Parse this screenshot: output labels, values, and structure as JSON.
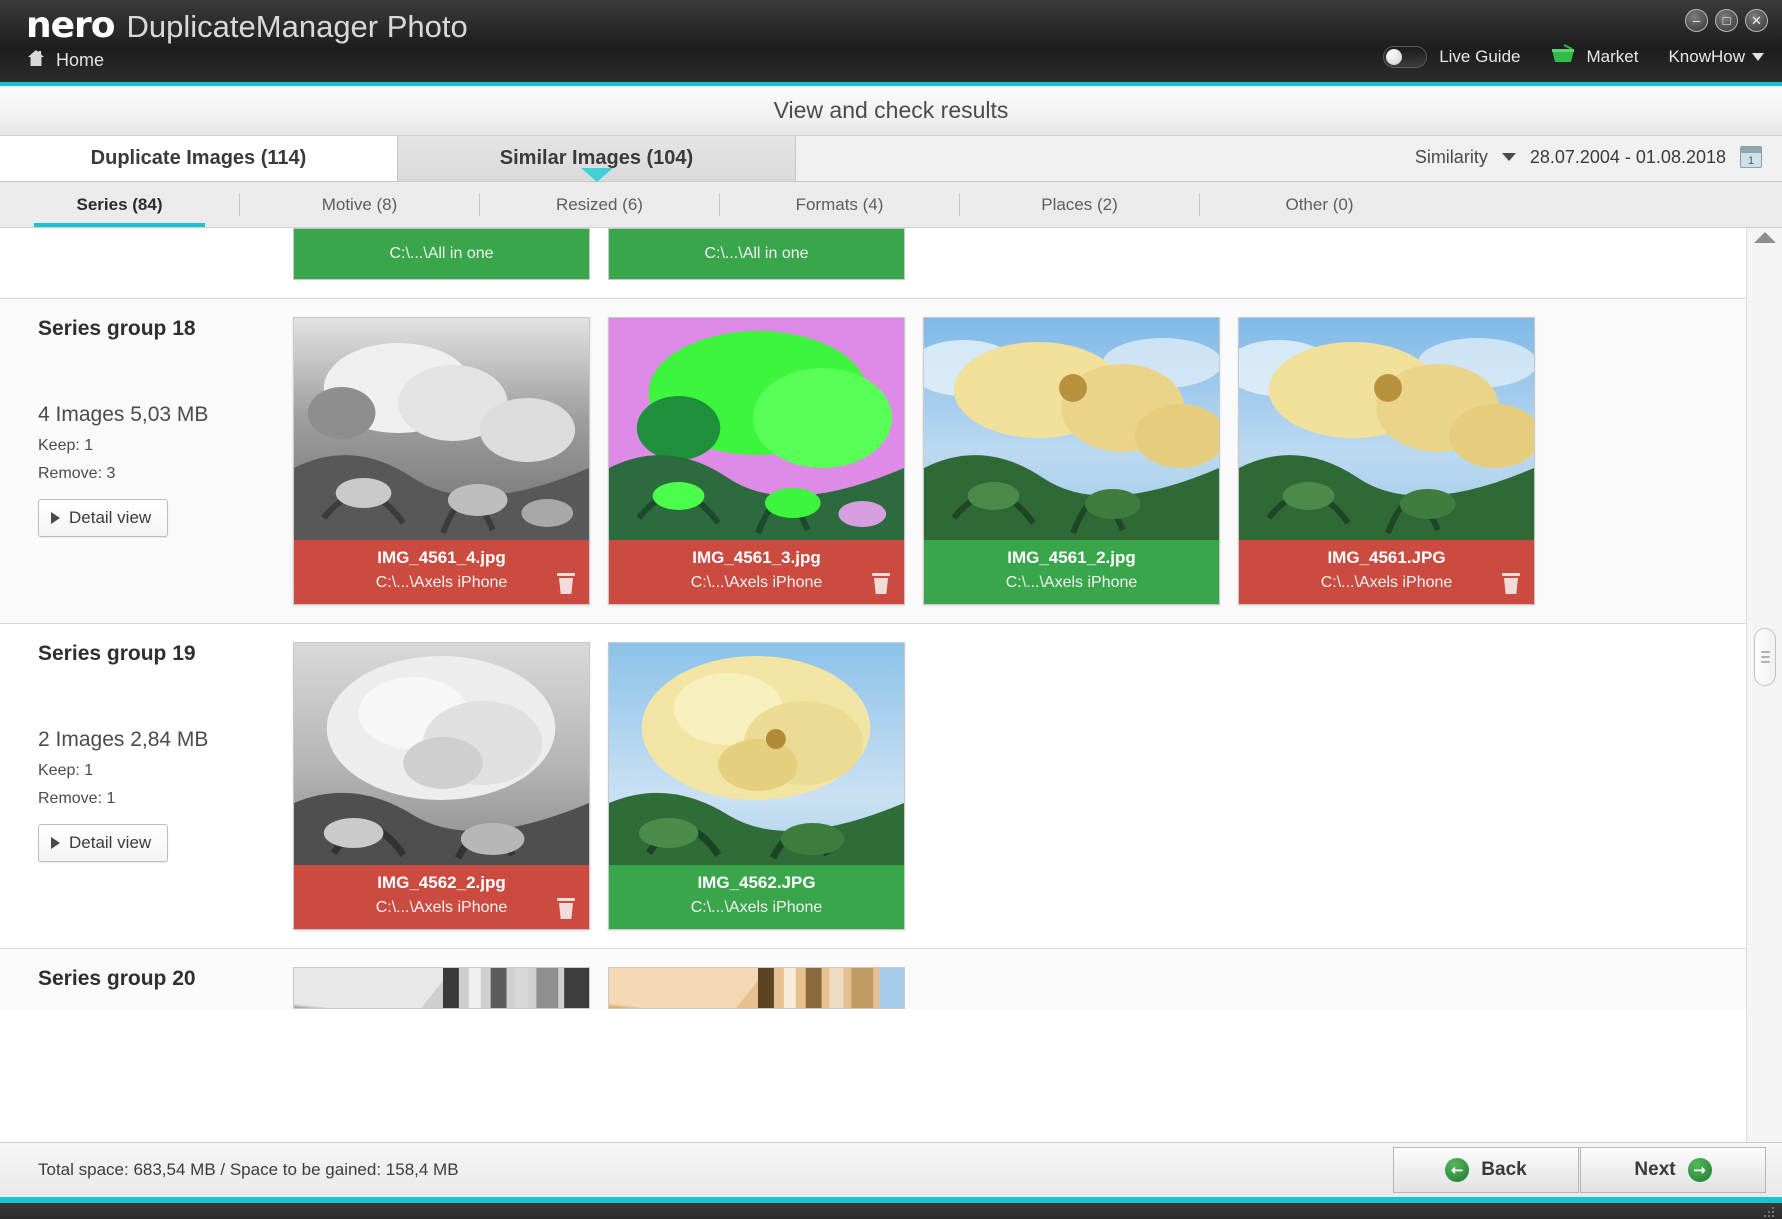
{
  "titlebar": {
    "brand": "nero",
    "app_name": "DuplicateManager Photo",
    "home_label": "Home",
    "live_guide_label": "Live Guide",
    "market_label": "Market",
    "knowhow_label": "KnowHow",
    "minimize_glyph": "–",
    "maximize_glyph": "□",
    "close_glyph": "✕",
    "accent_color": "#17c4cf"
  },
  "header": {
    "title": "View and check results"
  },
  "main_tabs": [
    {
      "label": "Duplicate Images (114)",
      "active": true
    },
    {
      "label": "Similar Images (104)",
      "active": false
    }
  ],
  "filterbar": {
    "similarity_label": "Similarity",
    "date_range": "28.07.2004 - 01.08.2018",
    "calendar_day": "1"
  },
  "sub_tabs": [
    {
      "label": "Series (84)",
      "active": true
    },
    {
      "label": "Motive (8)",
      "active": false
    },
    {
      "label": "Resized (6)",
      "active": false
    },
    {
      "label": "Formats (4)",
      "active": false
    },
    {
      "label": "Places (2)",
      "active": false
    },
    {
      "label": "Other (0)",
      "active": false
    }
  ],
  "partial_top": {
    "cards": [
      {
        "path": "C:\\...\\All in one",
        "state": "keep"
      },
      {
        "path": "C:\\...\\All in one",
        "state": "keep"
      }
    ]
  },
  "groups": [
    {
      "title": "Series group 18",
      "count_label": "4 Images  5,03 MB",
      "keep_label": "Keep: 1",
      "remove_label": "Remove: 3",
      "detail_label": "Detail view",
      "images": [
        {
          "name": "IMG_4561_4.jpg",
          "path": "C:\\...\\Axels iPhone",
          "state": "remove",
          "style": "gray-roses"
        },
        {
          "name": "IMG_4561_3.jpg",
          "path": "C:\\...\\Axels iPhone",
          "state": "remove",
          "style": "neon-roses"
        },
        {
          "name": "IMG_4561_2.jpg",
          "path": "C:\\...\\Axels iPhone",
          "state": "keep",
          "style": "yellow-roses"
        },
        {
          "name": "IMG_4561.JPG",
          "path": "C:\\...\\Axels iPhone",
          "state": "remove",
          "style": "yellow-roses"
        }
      ]
    },
    {
      "title": "Series group 19",
      "count_label": "2 Images  2,84 MB",
      "keep_label": "Keep: 1",
      "remove_label": "Remove: 1",
      "detail_label": "Detail view",
      "images": [
        {
          "name": "IMG_4562_2.jpg",
          "path": "C:\\...\\Axels iPhone",
          "state": "remove",
          "style": "gray-rose-close"
        },
        {
          "name": "IMG_4562.JPG",
          "path": "C:\\...\\Axels iPhone",
          "state": "keep",
          "style": "yellow-rose-close"
        }
      ]
    }
  ],
  "partial_bottom": {
    "title": "Series group 20",
    "cards": [
      {
        "style": "gray-building"
      },
      {
        "style": "ochre-building"
      }
    ]
  },
  "footer": {
    "status": "Total space: 683,54 MB / Space to be gained: 158,4 MB",
    "back_label": "Back",
    "next_label": "Next",
    "back_glyph": "←",
    "next_glyph": "→"
  },
  "colors": {
    "remove": "#cb4b41",
    "keep": "#3aa64c",
    "accent": "#17c4cf"
  }
}
